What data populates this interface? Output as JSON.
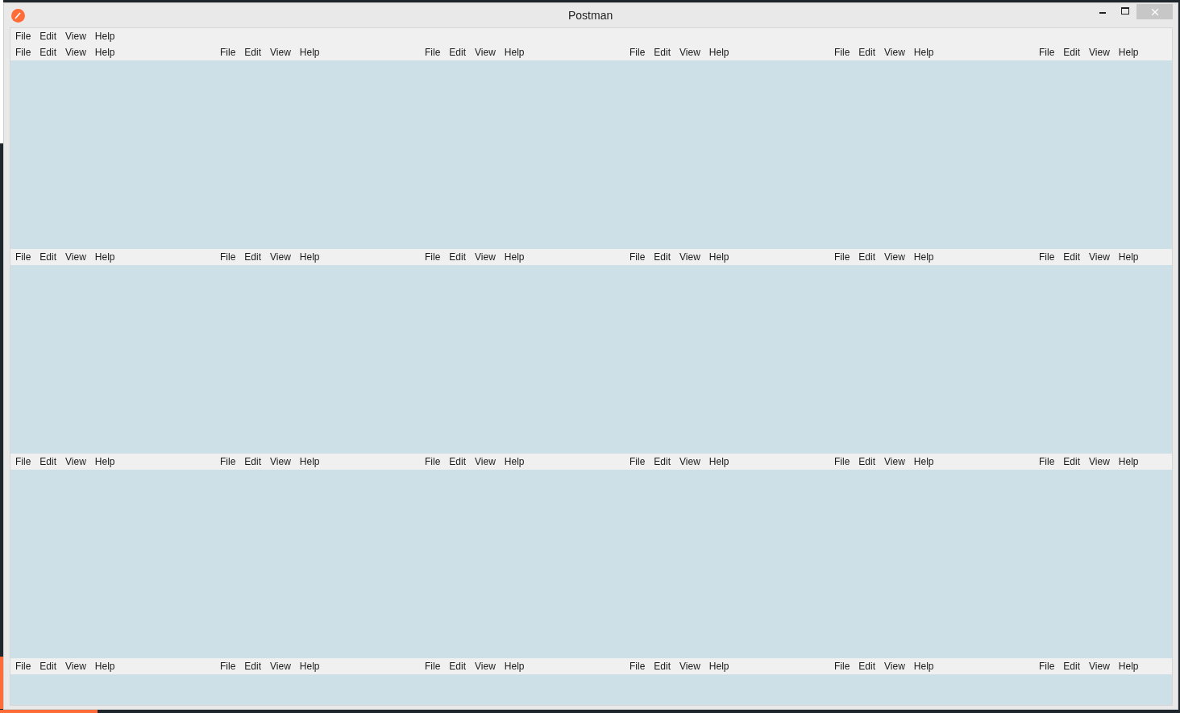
{
  "window": {
    "title": "Postman"
  },
  "menu_bar": {
    "items": [
      "File",
      "Edit",
      "View",
      "Help"
    ]
  },
  "panes": [
    {
      "menu": [
        "File",
        "Edit",
        "View",
        "Help"
      ]
    },
    {
      "menu": [
        "File",
        "Edit",
        "View",
        "Help"
      ]
    },
    {
      "menu": [
        "File",
        "Edit",
        "View",
        "Help"
      ]
    },
    {
      "menu": [
        "File",
        "Edit",
        "View",
        "Help"
      ]
    },
    {
      "menu": [
        "File",
        "Edit",
        "View",
        "Help"
      ]
    },
    {
      "menu": [
        "File",
        "Edit",
        "View",
        "Help"
      ]
    },
    {
      "menu": [
        "File",
        "Edit",
        "View",
        "Help"
      ]
    },
    {
      "menu": [
        "File",
        "Edit",
        "View",
        "Help"
      ]
    },
    {
      "menu": [
        "File",
        "Edit",
        "View",
        "Help"
      ]
    },
    {
      "menu": [
        "File",
        "Edit",
        "View",
        "Help"
      ]
    },
    {
      "menu": [
        "File",
        "Edit",
        "View",
        "Help"
      ]
    },
    {
      "menu": [
        "File",
        "Edit",
        "View",
        "Help"
      ]
    },
    {
      "menu": [
        "File",
        "Edit",
        "View",
        "Help"
      ]
    },
    {
      "menu": [
        "File",
        "Edit",
        "View",
        "Help"
      ]
    },
    {
      "menu": [
        "File",
        "Edit",
        "View",
        "Help"
      ]
    },
    {
      "menu": [
        "File",
        "Edit",
        "View",
        "Help"
      ]
    },
    {
      "menu": [
        "File",
        "Edit",
        "View",
        "Help"
      ]
    },
    {
      "menu": [
        "File",
        "Edit",
        "View",
        "Help"
      ]
    },
    {
      "menu": [
        "File",
        "Edit",
        "View",
        "Help"
      ]
    },
    {
      "menu": [
        "File",
        "Edit",
        "View",
        "Help"
      ]
    },
    {
      "menu": [
        "File",
        "Edit",
        "View",
        "Help"
      ]
    },
    {
      "menu": [
        "File",
        "Edit",
        "View",
        "Help"
      ]
    },
    {
      "menu": [
        "File",
        "Edit",
        "View",
        "Help"
      ]
    },
    {
      "menu": [
        "File",
        "Edit",
        "View",
        "Help"
      ]
    }
  ]
}
